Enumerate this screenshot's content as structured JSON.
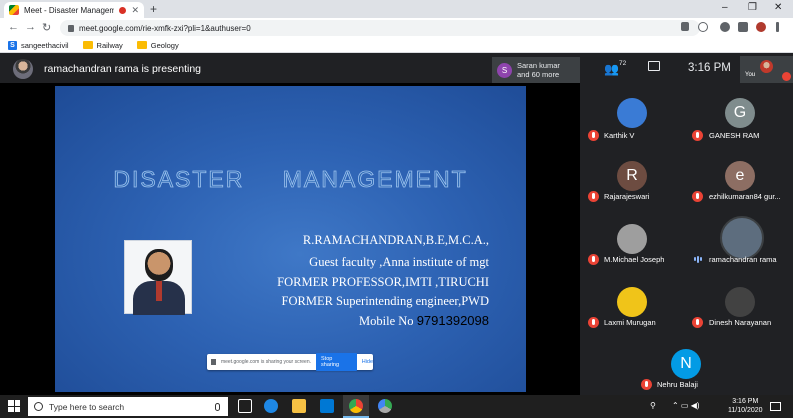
{
  "browser": {
    "tab_title": "Meet - Disaster Managemen",
    "new_tab_glyph": "+",
    "url": "meet.google.com/rie-xmfk-zxi?pli=1&authuser=0",
    "bookmarks": [
      {
        "label": "sangeethacivil",
        "icon": "site-s-icon"
      },
      {
        "label": "Railway",
        "icon": "folder-icon"
      },
      {
        "label": "Geology",
        "icon": "folder-icon"
      }
    ],
    "window_controls": [
      "–",
      "❐",
      "✕"
    ],
    "nav": {
      "back": "←",
      "forward": "→",
      "reload": "↻"
    }
  },
  "meet": {
    "presenting_text": "ramachandran rama is presenting",
    "joiner": {
      "initial": "S",
      "line1": "Saran kumar",
      "line2": "and 60 more",
      "color": "#8e44ad"
    },
    "people_count": "72",
    "clock": "3:16 PM",
    "you_label": "You"
  },
  "slide": {
    "title": "DISASTER    MANAGEMENT",
    "lines": [
      "R.RAMACHANDRAN,B.E,M.C.A.,",
      "Guest faculty ,Anna institute of mgt",
      "FORMER PROFESSOR,IMTI ,TIRUCHI",
      "FORMER Superintending engineer,PWD"
    ],
    "mobile_label": "Mobile No",
    "mobile_number": "9791392098",
    "share_text": "meet.google.com is sharing your screen.",
    "stop_label": "Stop sharing",
    "hide_label": "Hide"
  },
  "participants": [
    {
      "name": "Karthik V",
      "initial": "",
      "color": "#3a7bd5",
      "muted": true
    },
    {
      "name": "GANESH RAM",
      "initial": "G",
      "color": "#7f8c8d",
      "muted": true
    },
    {
      "name": "Rajarajeswari",
      "initial": "R",
      "color": "#6d4c41",
      "muted": true
    },
    {
      "name": "ezhilkumaran84 gur...",
      "initial": "e",
      "color": "#8d6e63",
      "muted": true
    },
    {
      "name": "M.Michael Joseph",
      "initial": "",
      "color": "#9e9e9e",
      "muted": true
    },
    {
      "name": "ramachandran rama",
      "initial": "",
      "color": "#5d6d7e",
      "muted": false
    },
    {
      "name": "Laxmi Murugan",
      "initial": "",
      "color": "#f0c419",
      "muted": true
    },
    {
      "name": "Dinesh Narayanan",
      "initial": "",
      "color": "#424242",
      "muted": true
    },
    {
      "name": "Nehru Balaji",
      "initial": "N",
      "color": "#039be5",
      "muted": true
    }
  ],
  "taskbar": {
    "search_placeholder": "Type here to search",
    "time": "3:16 PM",
    "date": "11/10/2020",
    "tray_glyphs": "⌃ ▭ ◀)"
  }
}
